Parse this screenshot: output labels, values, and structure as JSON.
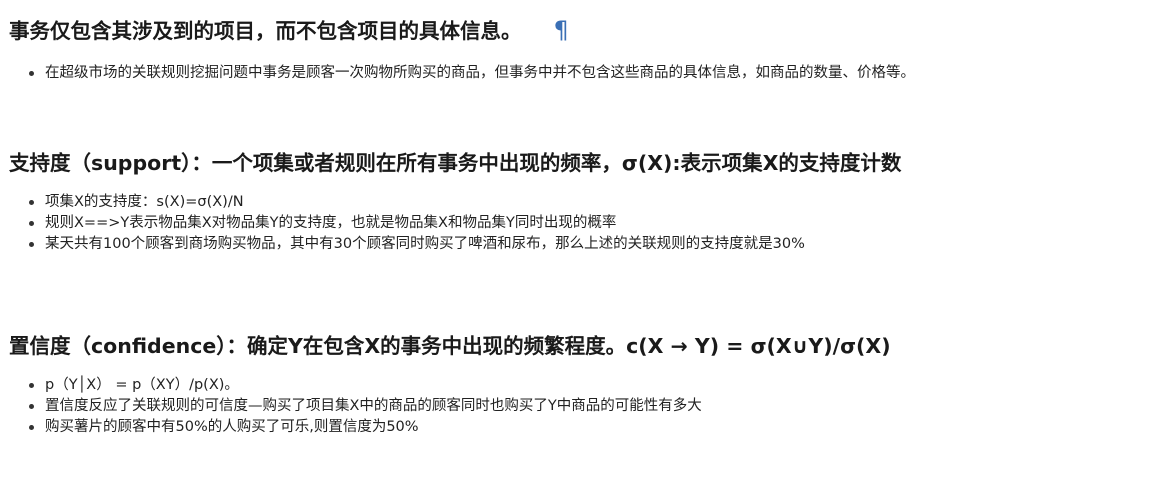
{
  "sections": [
    {
      "heading": "事务仅包含其涉及到的项目，而不包含项目的具体信息。",
      "pilcrow": "¶",
      "bullets": [
        "在超级市场的关联规则挖掘问题中事务是顾客一次购物所购买的商品，但事务中并不包含这些商品的具体信息，如商品的数量、价格等。"
      ]
    },
    {
      "heading": "支持度（support）：一个项集或者规则在所有事务中出现的频率，σ(X):表示项集X的支持度计数",
      "bullets": [
        "项集X的支持度：s(X)=σ(X)/N",
        "规则X==>Y表示物品集X对物品集Y的支持度，也就是物品集X和物品集Y同时出现的概率",
        "某天共有100个顾客到商场购买物品，其中有30个顾客同时购买了啤酒和尿布，那么上述的关联规则的支持度就是30%"
      ]
    },
    {
      "heading": "置信度（confidence）：确定Y在包含X的事务中出现的频繁程度。c(X → Y) = σ(X∪Y)/σ(X)",
      "bullets": [
        "p（Y│X） = p（XY）/p(X)。",
        "置信度反应了关联规则的可信度—购买了项目集X中的商品的顾客同时也购买了Y中商品的可能性有多大",
        "购买薯片的顾客中有50%的人购买了可乐,则置信度为50%"
      ]
    }
  ]
}
